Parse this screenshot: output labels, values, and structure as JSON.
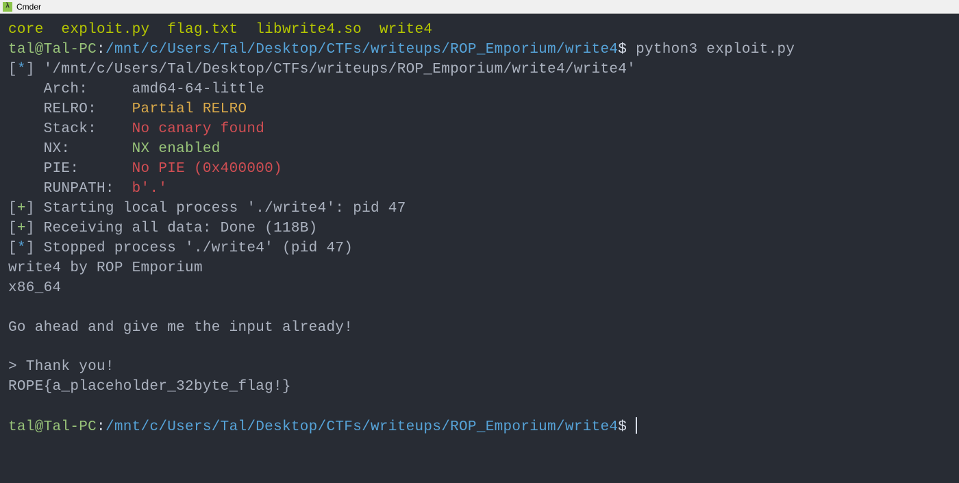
{
  "window": {
    "title": "Cmder",
    "icon_label": "λ"
  },
  "ls_files": "core  exploit.py  flag.txt  libwrite4.so  write4",
  "prompt": {
    "user_host": "tal@Tal-PC",
    "sep": ":",
    "path": "/mnt/c/Users/Tal/Desktop/CTFs/writeups/ROP_Emporium/write4",
    "dollar": "$"
  },
  "cmd1": " python3 exploit.py",
  "pwntools": {
    "info_tag": "[*]",
    "plus_tag": "[+]",
    "bin_path": " '/mnt/c/Users/Tal/Desktop/CTFs/writeups/ROP_Emporium/write4/write4'",
    "arch_label": "    Arch:     ",
    "arch_value": "amd64-64-little",
    "relro_label": "    RELRO:    ",
    "relro_value": "Partial RELRO",
    "stack_label": "    Stack:    ",
    "stack_value": "No canary found",
    "nx_label": "    NX:       ",
    "nx_value": "NX enabled",
    "pie_label": "    PIE:      ",
    "pie_value": "No PIE (0x400000)",
    "runpath_label": "    RUNPATH:  ",
    "runpath_value": "b'.'",
    "start_proc": " Starting local process './write4': pid 47",
    "recv_data": " Receiving all data: Done (118B)",
    "stopped": " Stopped process './write4' (pid 47)"
  },
  "prog_output": {
    "banner": "write4 by ROP Emporium",
    "arch": "x86_64",
    "blank": "",
    "prompt_line": "Go ahead and give me the input already!",
    "thanks": "> Thank you!",
    "flag": "ROPE{a_placeholder_32byte_flag!}"
  }
}
